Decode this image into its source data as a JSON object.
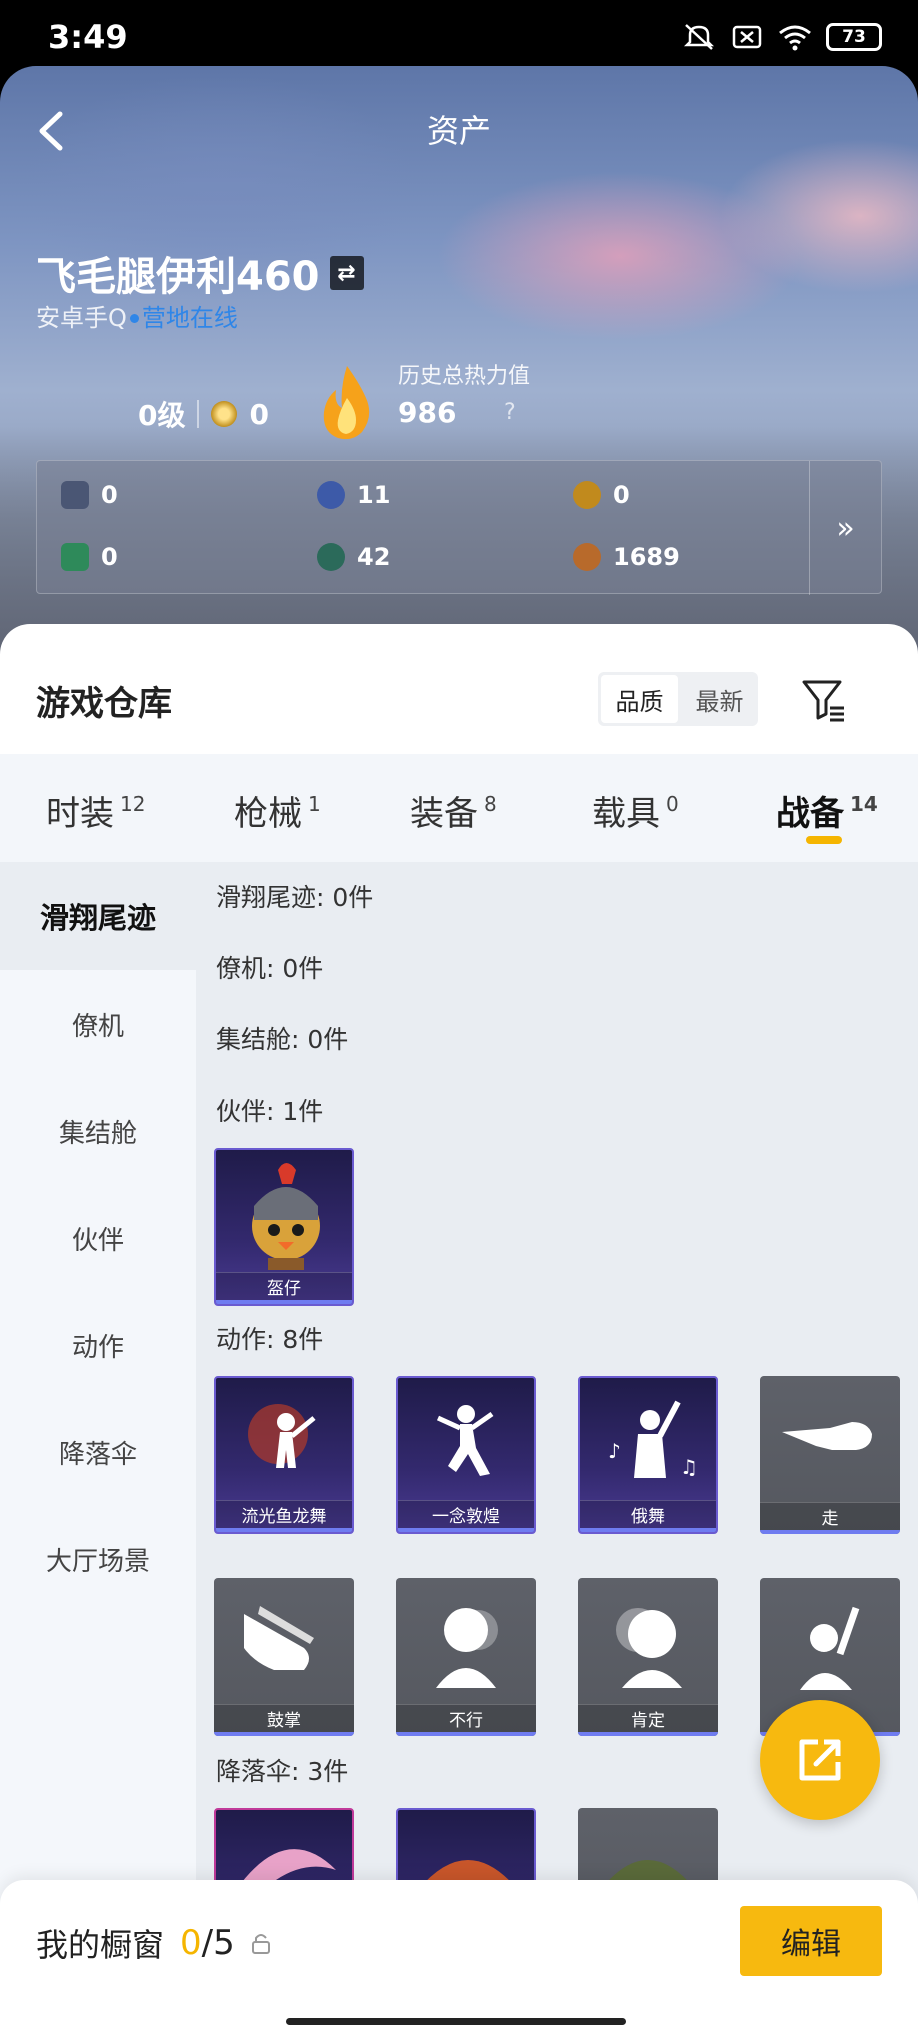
{
  "status_bar": {
    "time": "3:49",
    "battery": "73"
  },
  "header": {
    "title": "资产",
    "back_icon": "chevron-left-icon"
  },
  "profile": {
    "name": "飞毛腿伊利460",
    "platform": "安卓手Q",
    "status": "营地在线",
    "level": "0级",
    "medal_count": "0",
    "heat_label": "历史总热力值",
    "heat_value": "986",
    "heat_help": "?"
  },
  "stats": [
    {
      "icon": "card-icon",
      "value": "0",
      "color": "#4a5674"
    },
    {
      "icon": "coin-blue-icon",
      "value": "11",
      "color": "#3d5aa8"
    },
    {
      "icon": "coin-gold-icon",
      "value": "0",
      "color": "#c18a1d"
    },
    {
      "icon": "green-card-icon",
      "value": "0",
      "color": "#2e8a5a"
    },
    {
      "icon": "orb-icon",
      "value": "42",
      "color": "#2b6a5a"
    },
    {
      "icon": "token-icon",
      "value": "1689",
      "color": "#b86a2b"
    }
  ],
  "warehouse": {
    "title": "游戏仓库",
    "sort_options": [
      "品质",
      "最新"
    ],
    "sort_active": "品质",
    "tabs": [
      {
        "label": "时装",
        "count": "12"
      },
      {
        "label": "枪械",
        "count": "1"
      },
      {
        "label": "装备",
        "count": "8"
      },
      {
        "label": "载具",
        "count": "0"
      },
      {
        "label": "战备",
        "count": "14"
      }
    ],
    "active_tab": "战备",
    "side_items": [
      "滑翔尾迹",
      "僚机",
      "集结舱",
      "伙伴",
      "动作",
      "降落伞",
      "大厅场景"
    ],
    "active_side": "滑翔尾迹",
    "sections": {
      "trail": "滑翔尾迹: 0件",
      "wingman": "僚机: 0件",
      "pod": "集结舱: 0件",
      "partner": "伙伴: 1件",
      "emote": "动作: 8件",
      "parachute": "降落伞: 3件"
    },
    "partner_items": [
      "盔仔"
    ],
    "emote_items": [
      "流光鱼龙舞",
      "一念敦煌",
      "俄舞",
      "走",
      "鼓掌",
      "不行",
      "肯定",
      ""
    ]
  },
  "showcase": {
    "label": "我的橱窗",
    "current": "0",
    "total": "/5",
    "edit_label": "编辑"
  },
  "colors": {
    "accent": "#f7b90f",
    "online": "#2f86e8",
    "rarity_purple": "#6a5bd0"
  }
}
